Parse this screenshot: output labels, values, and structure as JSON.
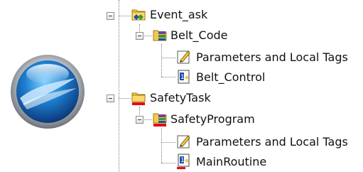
{
  "tree": {
    "items": [
      {
        "label": "Event_ask",
        "icon": "event-task-folder-icon",
        "expanded": true
      },
      {
        "label": "Belt_Code",
        "icon": "program-icon",
        "expanded": true
      },
      {
        "label": "Parameters and Local Tags",
        "icon": "parameters-tags-icon"
      },
      {
        "label": "Belt_Control",
        "icon": "main-routine-icon"
      },
      {
        "label": "SafetyTask",
        "icon": "safety-task-folder-icon",
        "expanded": true
      },
      {
        "label": "SafetyProgram",
        "icon": "safety-program-icon",
        "expanded": true
      },
      {
        "label": "Parameters and Local Tags",
        "icon": "parameters-tags-icon"
      },
      {
        "label": "MainRoutine",
        "icon": "safety-main-routine-icon"
      }
    ]
  },
  "logo": {
    "icon": "blue-orb-logo-icon"
  },
  "colors": {
    "folder_yellow": "#f2c94c",
    "safety_red": "#e01010",
    "program_green": "#2f9e2f",
    "routine_blue": "#1c4fb0"
  }
}
